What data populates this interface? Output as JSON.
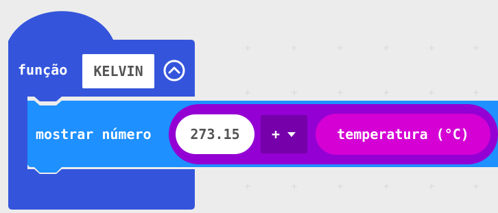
{
  "colors": {
    "workspace_bg": "#ececec",
    "function_block": "#3455db",
    "basic_block": "#1e90ff",
    "math_block": "#9400d3",
    "sensor_reporter": "#d400d4",
    "text_white": "#ffffff",
    "field_text": "#545454"
  },
  "function_block": {
    "keyword": "função",
    "name": "KELVIN",
    "collapse_icon": "chevron-up-circle-icon"
  },
  "show_number_block": {
    "label": "mostrar número"
  },
  "math_block": {
    "left_value": "273.15",
    "operator": "+",
    "operator_dropdown_icon": "triangle-down-icon"
  },
  "temperature_block": {
    "label": "temperatura (°C)"
  }
}
